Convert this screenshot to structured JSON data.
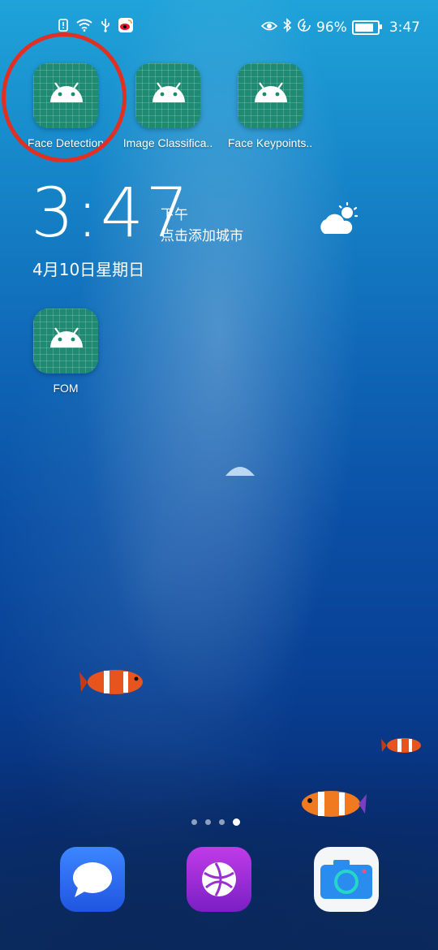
{
  "status_bar": {
    "battery": "96%",
    "time": "3:47"
  },
  "apps": [
    {
      "label": "Face Detection",
      "icon": "android-icon"
    },
    {
      "label": "Image Classifica..",
      "icon": "android-icon"
    },
    {
      "label": "Face Keypoints..",
      "icon": "android-icon"
    },
    {
      "label": "FOM",
      "icon": "android-icon"
    }
  ],
  "clock_widget": {
    "time": "3:47",
    "period": "下午",
    "city_prompt": "点击添加城市",
    "date": "4月10日星期日",
    "weather_icon": "partly-cloudy-icon"
  },
  "page_indicator": {
    "pages": 4,
    "current": 4
  },
  "dock": [
    {
      "name": "messages-icon",
      "color": "#2f6ff0"
    },
    {
      "name": "browser-icon",
      "color": "#9b2fd6"
    },
    {
      "name": "camera-icon",
      "color": "#ffffff"
    }
  ],
  "colors": {
    "highlight_circle": "#e03024",
    "app_icon_bg": "#1f8a72"
  }
}
